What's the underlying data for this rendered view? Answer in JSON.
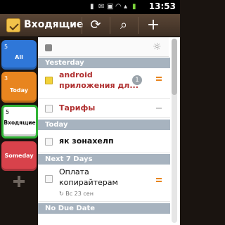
{
  "status_bar": {
    "time": "13:53",
    "icons": [
      "usb-icon",
      "notification-icon",
      "cast-icon",
      "wifi-icon",
      "signal-icon",
      "battery-icon"
    ]
  },
  "action_bar": {
    "title": "Входящие",
    "buttons": [
      "sync-icon",
      "search-icon",
      "add-icon"
    ]
  },
  "filters": [
    {
      "count": "5",
      "label": "All",
      "color": "#2f77d8"
    },
    {
      "count": "3",
      "label": "Today",
      "color": "#e8851f"
    },
    {
      "count": "5",
      "label": "Входящие",
      "color": "#31b436"
    },
    {
      "count": "",
      "label": "Someday",
      "color": "#d8424b"
    }
  ],
  "sections": {
    "yesterday": "Yesterday",
    "today": "Today",
    "next7": "Next 7 Days",
    "nodue": "No Due Date"
  },
  "tasks": [
    {
      "title_line1": "android",
      "title_line2": "приложения дл...",
      "badge": "1",
      "priority": "orange",
      "checkbox": "yellow"
    },
    {
      "title": "Тарифы",
      "priority": "none"
    },
    {
      "title": "як зонахелп"
    },
    {
      "title_line1": "Оплата",
      "title_line2": "копирайтерам",
      "meta": "Вс 23 сен",
      "priority": "orange"
    }
  ]
}
